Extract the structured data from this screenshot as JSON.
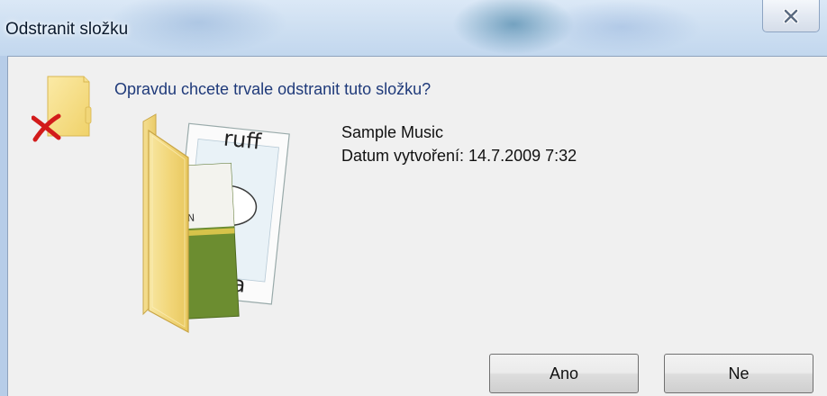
{
  "window": {
    "title": "Odstranit složku"
  },
  "dialog": {
    "question": "Opravdu chcete trvale odstranit tuto složku?",
    "item_name": "Sample Music",
    "item_date": "Datum vytvoření: 14.7.2009 7:32",
    "icons": {
      "title_close": "close-icon",
      "small": "folder-delete-icon",
      "large": "music-folder-icon"
    }
  },
  "buttons": {
    "yes_label": "Ano",
    "no_label": "Ne"
  },
  "colors": {
    "question_text": "#1f3a7a",
    "dialog_background": "#f0f0f0",
    "titlebar": "#cfe0f2",
    "delete_mark": "#d21b1b"
  }
}
